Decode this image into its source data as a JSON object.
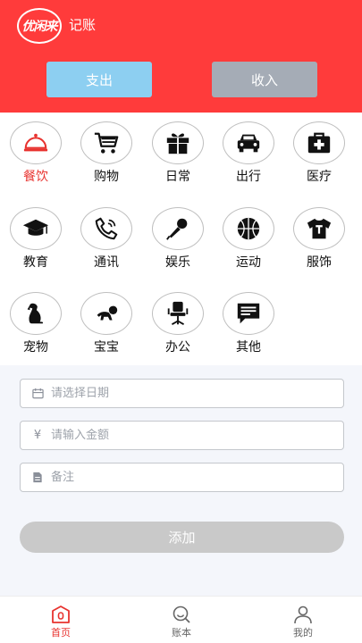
{
  "header": {
    "logo_text": "优闲来",
    "title": "记账",
    "tabs": {
      "expense": "支出",
      "income": "收入"
    }
  },
  "categories": [
    {
      "label": "餐饮",
      "icon": "food-cover-icon",
      "active": true
    },
    {
      "label": "购物",
      "icon": "shopping-cart-icon"
    },
    {
      "label": "日常",
      "icon": "gift-icon"
    },
    {
      "label": "出行",
      "icon": "car-icon"
    },
    {
      "label": "医疗",
      "icon": "medical-kit-icon"
    },
    {
      "label": "教育",
      "icon": "graduation-cap-icon"
    },
    {
      "label": "通讯",
      "icon": "phone-icon"
    },
    {
      "label": "娱乐",
      "icon": "microphone-icon"
    },
    {
      "label": "运动",
      "icon": "basketball-icon"
    },
    {
      "label": "服饰",
      "icon": "tshirt-icon"
    },
    {
      "label": "宠物",
      "icon": "dog-icon"
    },
    {
      "label": "宝宝",
      "icon": "baby-icon"
    },
    {
      "label": "办公",
      "icon": "office-chair-icon"
    },
    {
      "label": "其他",
      "icon": "message-icon"
    }
  ],
  "form": {
    "date_placeholder": "请选择日期",
    "amount_placeholder": "请输入金额",
    "note_placeholder": "备注",
    "currency_symbol": "¥",
    "add_label": "添加"
  },
  "tabbar": {
    "home": "首页",
    "ledger": "账本",
    "mine": "我的"
  },
  "colors": {
    "brand_red": "#ff3b3b",
    "active_text": "#e8332f",
    "expense_btn": "#8dcff1",
    "income_btn": "#a5acb6"
  }
}
